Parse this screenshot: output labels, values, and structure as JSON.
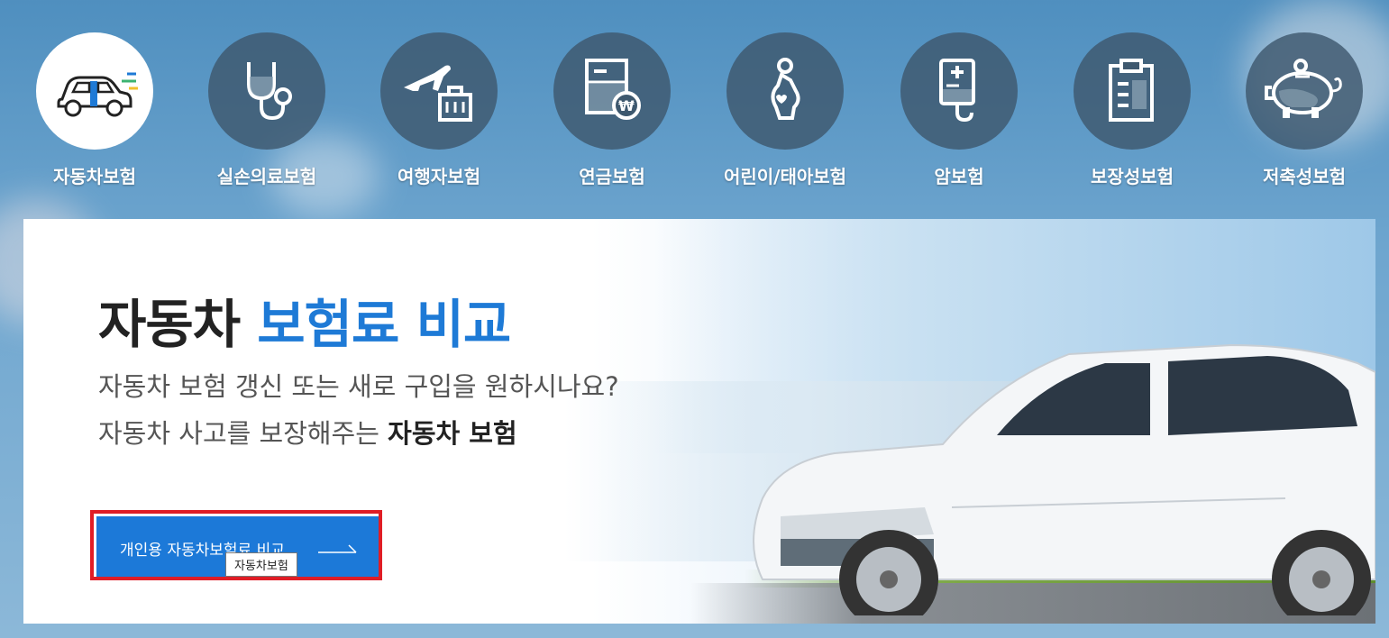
{
  "nav": {
    "items": [
      {
        "label": "자동차보험",
        "icon": "car-icon",
        "active": true
      },
      {
        "label": "실손의료보험",
        "icon": "stethoscope-icon",
        "active": false
      },
      {
        "label": "여행자보험",
        "icon": "airplane-luggage-icon",
        "active": false
      },
      {
        "label": "연금보험",
        "icon": "pension-document-icon",
        "active": false
      },
      {
        "label": "어린이/태아보험",
        "icon": "pregnant-woman-icon",
        "active": false
      },
      {
        "label": "암보험",
        "icon": "iv-bag-icon",
        "active": false
      },
      {
        "label": "보장성보험",
        "icon": "clipboard-icon",
        "active": false
      },
      {
        "label": "저축성보험",
        "icon": "piggy-bank-icon",
        "active": false
      }
    ]
  },
  "banner": {
    "title_main": "자동차",
    "title_accent": "보험료 비교",
    "subtitle_line1": "자동차 보험 갱신 또는 새로 구입을 원하시나요?",
    "subtitle_line2_prefix": "자동차 사고를 보장해주는",
    "subtitle_line2_bold": "자동차 보험",
    "cta_label": "개인용 자동차보험료 비교",
    "tooltip": "자동차보험"
  },
  "colors": {
    "accent": "#1e7ad6",
    "cta_bg": "#1c79d8",
    "highlight_border": "#e01d25",
    "nav_circle": "#3e586e"
  }
}
